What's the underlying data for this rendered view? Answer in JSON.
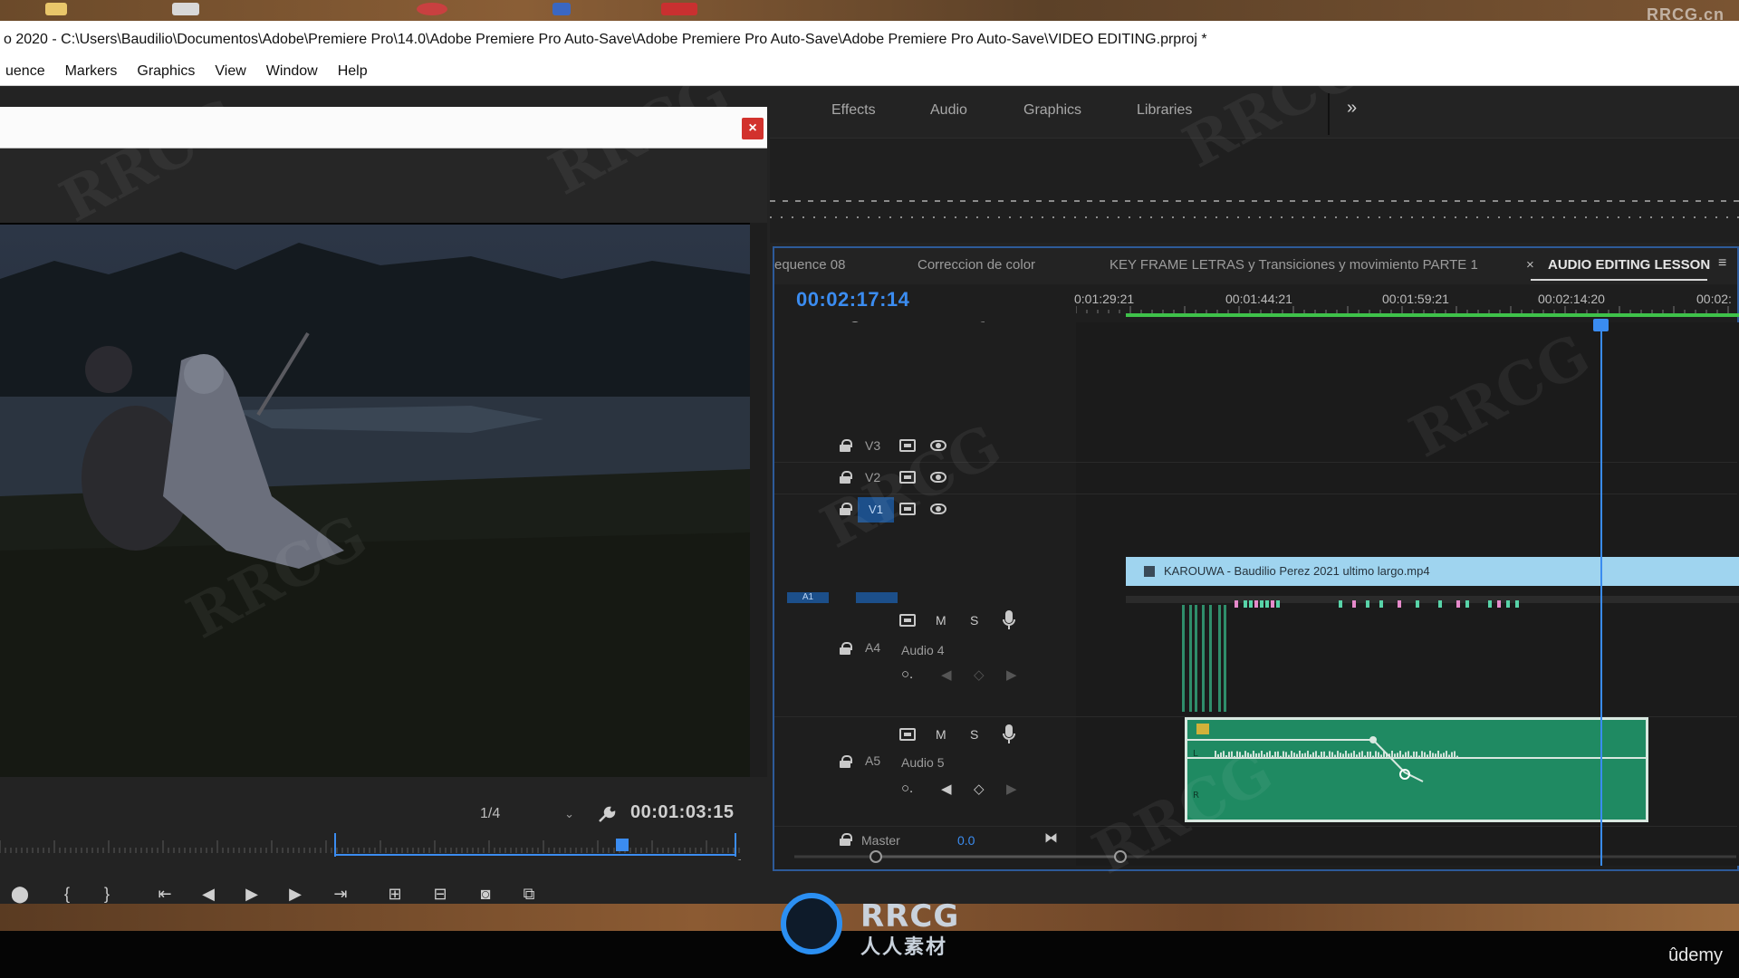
{
  "window": {
    "title": "o 2020 - C:\\Users\\Baudilio\\Documentos\\Adobe\\Premiere Pro\\14.0\\Adobe Premiere Pro Auto-Save\\Adobe Premiere Pro Auto-Save\\Adobe Premiere Pro Auto-Save\\VIDEO EDITING.prproj *"
  },
  "menu": {
    "items": [
      "uence",
      "Markers",
      "Graphics",
      "View",
      "Window",
      "Help"
    ]
  },
  "panel_tabs": {
    "items": [
      "Effects",
      "Audio",
      "Graphics",
      "Libraries"
    ],
    "overflow": "»"
  },
  "dialog": {
    "close": "×"
  },
  "source_monitor": {
    "scale": "1/4",
    "timecode": "00:01:03:15"
  },
  "timeline": {
    "tabs": [
      "equence 08",
      "Correccion de color",
      "KEY FRAME LETRAS y Transiciones y movimiento PARTE 1"
    ],
    "active_tab": "AUDIO EDITING LESSON",
    "close": "×",
    "menu_icon": "≡",
    "timecode": "00:02:17:14",
    "ruler_labels": [
      "0:01:29:21",
      "00:01:44:21",
      "00:01:59:21",
      "00:02:14:20",
      "00:02:"
    ],
    "tracks": {
      "v3": "V3",
      "v2": "V2",
      "v1": "V1",
      "a1": "A1",
      "a4": "A4",
      "a4_name": "Audio 4",
      "a5": "A5",
      "a5_name": "Audio 5",
      "master": "Master",
      "master_value": "0.0",
      "m": "M",
      "s": "S"
    },
    "video_clip": "KAROUWA - Baudilio Perez 2021 ultimo largo.mp4",
    "colors": {
      "accent": "#3b8cf0",
      "video_clip": "#9fd4ef",
      "audio_clip": "#1f8a62",
      "inout": "#3fc24a"
    }
  },
  "branding": {
    "corner_mark": "RRCG.cn",
    "logo_line1": "RRCG",
    "logo_line2": "人人素材",
    "udemy": "ûdemy"
  }
}
